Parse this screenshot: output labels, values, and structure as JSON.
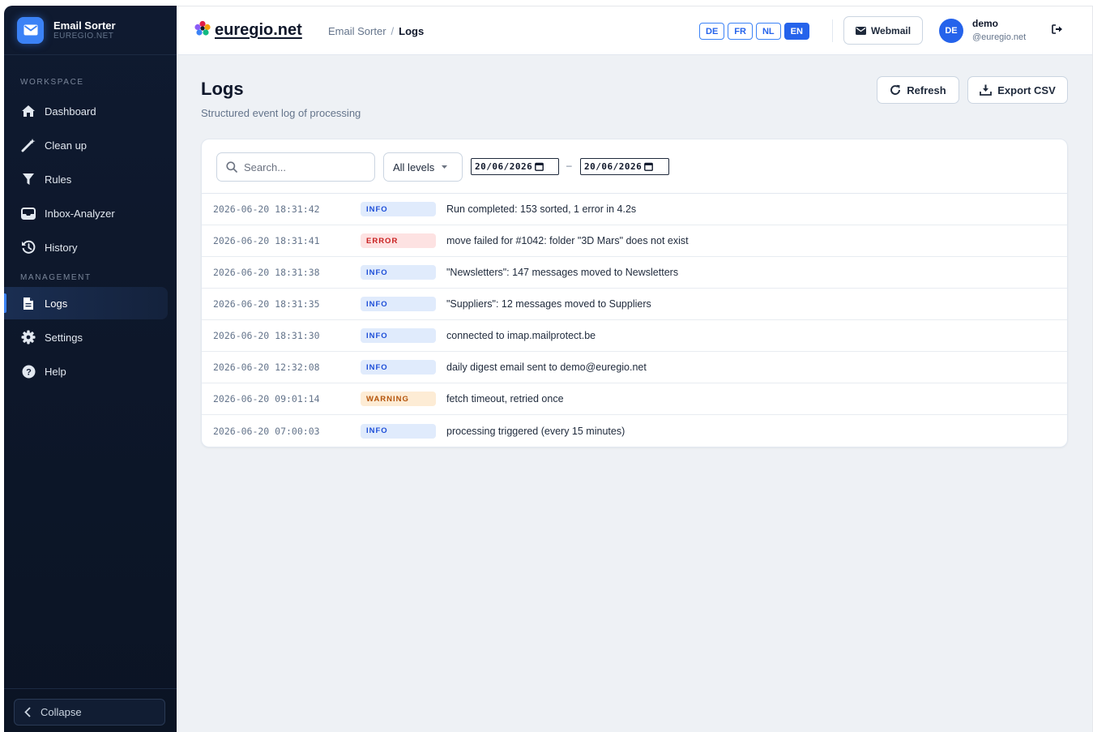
{
  "app": {
    "name": "Email Sorter",
    "sub": "EUREGIO.NET"
  },
  "sidebar": {
    "workspace_label": "WORKSPACE",
    "management_label": "MANAGEMENT",
    "workspace_items": [
      {
        "label": "Dashboard",
        "icon": "home-icon"
      },
      {
        "label": "Clean up",
        "icon": "magic-wand-icon"
      },
      {
        "label": "Rules",
        "icon": "filter-icon"
      },
      {
        "label": "Inbox-Analyzer",
        "icon": "inbox-icon"
      },
      {
        "label": "History",
        "icon": "history-icon"
      }
    ],
    "management_items": [
      {
        "label": "Logs",
        "icon": "file-icon",
        "active": true
      },
      {
        "label": "Settings",
        "icon": "gear-icon"
      },
      {
        "label": "Help",
        "icon": "help-icon"
      }
    ],
    "collapse_label": "Collapse"
  },
  "topbar": {
    "logo_text": "euregio.net",
    "breadcrumb": {
      "parent": "Email Sorter",
      "separator": "/",
      "current": "Logs"
    },
    "languages": [
      "DE",
      "FR",
      "NL",
      "EN"
    ],
    "active_language": "EN",
    "webmail_label": "Webmail",
    "user": {
      "initials": "DE",
      "name": "demo",
      "email": "@euregio.net"
    }
  },
  "page": {
    "title": "Logs",
    "subtitle": "Structured event log of processing",
    "refresh_label": "Refresh",
    "export_label": "Export CSV"
  },
  "filters": {
    "search_placeholder": "Search...",
    "level_value": "All levels",
    "date_from": "20/06/2026",
    "date_to": "20/06/2026",
    "range_separator": "–"
  },
  "logs": [
    {
      "timestamp": "2026-06-20 18:31:42",
      "level": "INFO",
      "message": "Run completed: 153 sorted, 1 error in 4.2s"
    },
    {
      "timestamp": "2026-06-20 18:31:41",
      "level": "ERROR",
      "message": "move failed for #1042: folder \"3D Mars\" does not exist"
    },
    {
      "timestamp": "2026-06-20 18:31:38",
      "level": "INFO",
      "message": "\"Newsletters\": 147 messages moved to Newsletters"
    },
    {
      "timestamp": "2026-06-20 18:31:35",
      "level": "INFO",
      "message": "\"Suppliers\": 12 messages moved to Suppliers"
    },
    {
      "timestamp": "2026-06-20 18:31:30",
      "level": "INFO",
      "message": "connected to imap.mailprotect.be"
    },
    {
      "timestamp": "2026-06-20 12:32:08",
      "level": "INFO",
      "message": "daily digest email sent to demo@euregio.net"
    },
    {
      "timestamp": "2026-06-20 09:01:14",
      "level": "WARNING",
      "message": "fetch timeout, retried once"
    },
    {
      "timestamp": "2026-06-20 07:00:03",
      "level": "INFO",
      "message": "processing triggered (every 15 minutes)"
    }
  ],
  "colors": {
    "accent": "#2563eb",
    "sidebar_bg": "#0f1a30",
    "main_bg": "#eef1f5"
  }
}
